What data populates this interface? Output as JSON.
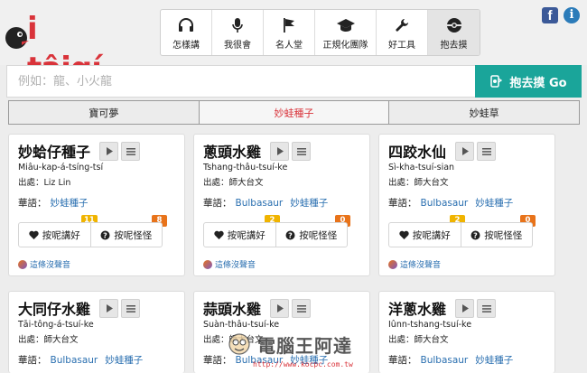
{
  "logo": {
    "text": "i tâigí"
  },
  "nav": [
    {
      "label": "怎樣講",
      "icon": "headphones-icon"
    },
    {
      "label": "我很會",
      "icon": "microphone-icon"
    },
    {
      "label": "名人堂",
      "icon": "flag-icon"
    },
    {
      "label": "正規化團隊",
      "icon": "graduation-cap-icon"
    },
    {
      "label": "好工具",
      "icon": "wrench-icon"
    },
    {
      "label": "抱去摸",
      "icon": "pokeball-icon",
      "active": true
    }
  ],
  "search": {
    "placeholder": "例如：龍、小火龍",
    "button_label": "抱去摸 Go"
  },
  "tabs": [
    {
      "label": "寶可夢"
    },
    {
      "label": "妙蛙種子",
      "active": true
    },
    {
      "label": "妙蛙草"
    }
  ],
  "cards": [
    {
      "title": "妙蛤仔種子",
      "romaji": "Miâu-kap-á-tsíng-tsí",
      "source": "出處：Liz Lin",
      "trans_label": "華語：",
      "trans_values": [
        "妙蛙種子"
      ],
      "good_label": "按呢講好",
      "bad_label": "按呢怪怪",
      "good_count": "11",
      "bad_count": "8",
      "sound_note": "這條沒聲音"
    },
    {
      "title": "蔥頭水雞",
      "romaji": "Tshang-thâu-tsuí-ke",
      "source": "出處：師大台文",
      "trans_label": "華語：",
      "trans_values": [
        "Bulbasaur",
        "妙蛙種子"
      ],
      "good_label": "按呢講好",
      "bad_label": "按呢怪怪",
      "good_count": "2",
      "bad_count": "0",
      "sound_note": "這條沒聲音"
    },
    {
      "title": "四跤水仙",
      "romaji": "Sì-kha-tsuí-sian",
      "source": "出處：師大台文",
      "trans_label": "華語：",
      "trans_values": [
        "Bulbasaur",
        "妙蛙種子"
      ],
      "good_label": "按呢講好",
      "bad_label": "按呢怪怪",
      "good_count": "2",
      "bad_count": "0",
      "sound_note": "這條沒聲音"
    },
    {
      "title": "大同仔水雞",
      "romaji": "Tāi-tông-á-tsuí-ke",
      "source": "出處：師大台文",
      "trans_label": "華語：",
      "trans_values": [
        "Bulbasaur",
        "妙蛙種子"
      ]
    },
    {
      "title": "蒜頭水雞",
      "romaji": "Suàn-thâu-tsuí-ke",
      "source": "出處：師大台文",
      "trans_label": "華語：",
      "trans_values": [
        "Bulbasaur",
        "妙蛙種子"
      ]
    },
    {
      "title": "洋蔥水雞",
      "romaji": "Iûnn-tshang-tsuí-ke",
      "source": "出處：師大台文",
      "trans_label": "華語：",
      "trans_values": [
        "Bulbasaur",
        "妙蛙種子"
      ]
    }
  ],
  "watermark": {
    "text": "電腦王阿達",
    "url": "http://www.kocpc.com.tw"
  }
}
